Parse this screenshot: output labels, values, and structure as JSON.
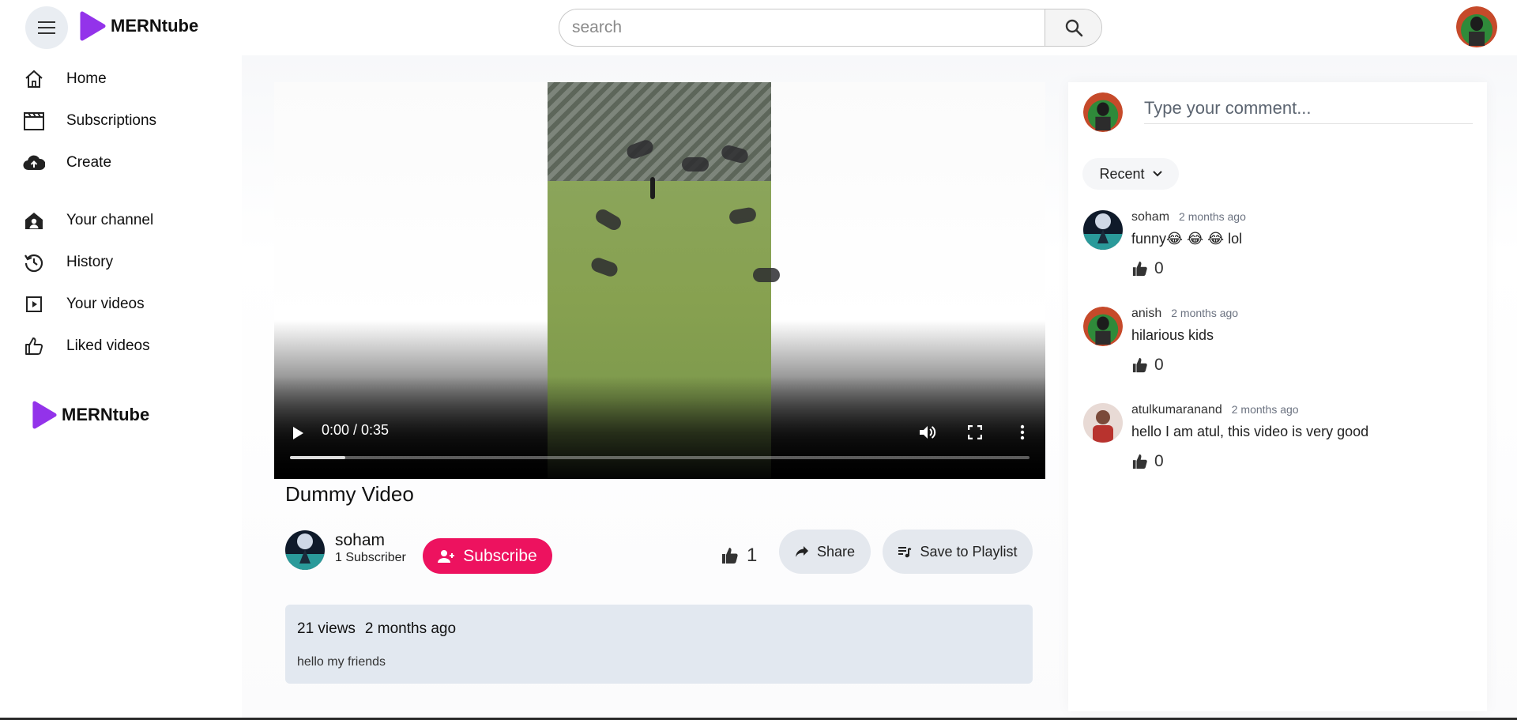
{
  "app": {
    "brand": "MERNtube"
  },
  "colors": {
    "accent": "#9333ea",
    "subscribe": "#ed125f",
    "pill": "#e4e8ee",
    "description_bg": "#e2e8f0"
  },
  "header": {
    "search_placeholder": "search",
    "icons": [
      "menu-icon",
      "search-icon",
      "avatar"
    ]
  },
  "sidebar": {
    "items": [
      {
        "label": "Home",
        "icon": "home-icon"
      },
      {
        "label": "Subscriptions",
        "icon": "subscriptions-icon"
      },
      {
        "label": "Create",
        "icon": "cloud-upload-icon"
      },
      {
        "label": "Your channel",
        "icon": "channel-icon"
      },
      {
        "label": "History",
        "icon": "history-icon"
      },
      {
        "label": "Your videos",
        "icon": "your-videos-icon"
      },
      {
        "label": "Liked videos",
        "icon": "thumb-up-icon"
      }
    ],
    "footer_brand": "MERNtube"
  },
  "video": {
    "current_time": "0:00",
    "duration": "0:35",
    "time_display": "0:00 / 0:35",
    "title": "Dummy Video"
  },
  "channel": {
    "name": "soham",
    "subscribers": "1 Subscriber",
    "subscribe_label": "Subscribe"
  },
  "actions": {
    "likes": "1",
    "share_label": "Share",
    "save_label": "Save to Playlist"
  },
  "description": {
    "views": "21 views",
    "age": "2 months ago",
    "text": "hello my friends"
  },
  "comments_panel": {
    "input_placeholder": "Type your comment...",
    "sort_label": "Recent",
    "comments": [
      {
        "user": "soham",
        "time": "2 months ago",
        "text": "funny😂 😂 😂 lol",
        "likes": "0"
      },
      {
        "user": "anish",
        "time": "2 months ago",
        "text": "hilarious kids",
        "likes": "0"
      },
      {
        "user": "atulkumaranand",
        "time": "2 months ago",
        "text": "hello I am atul, this video is very good",
        "likes": "0"
      }
    ]
  }
}
